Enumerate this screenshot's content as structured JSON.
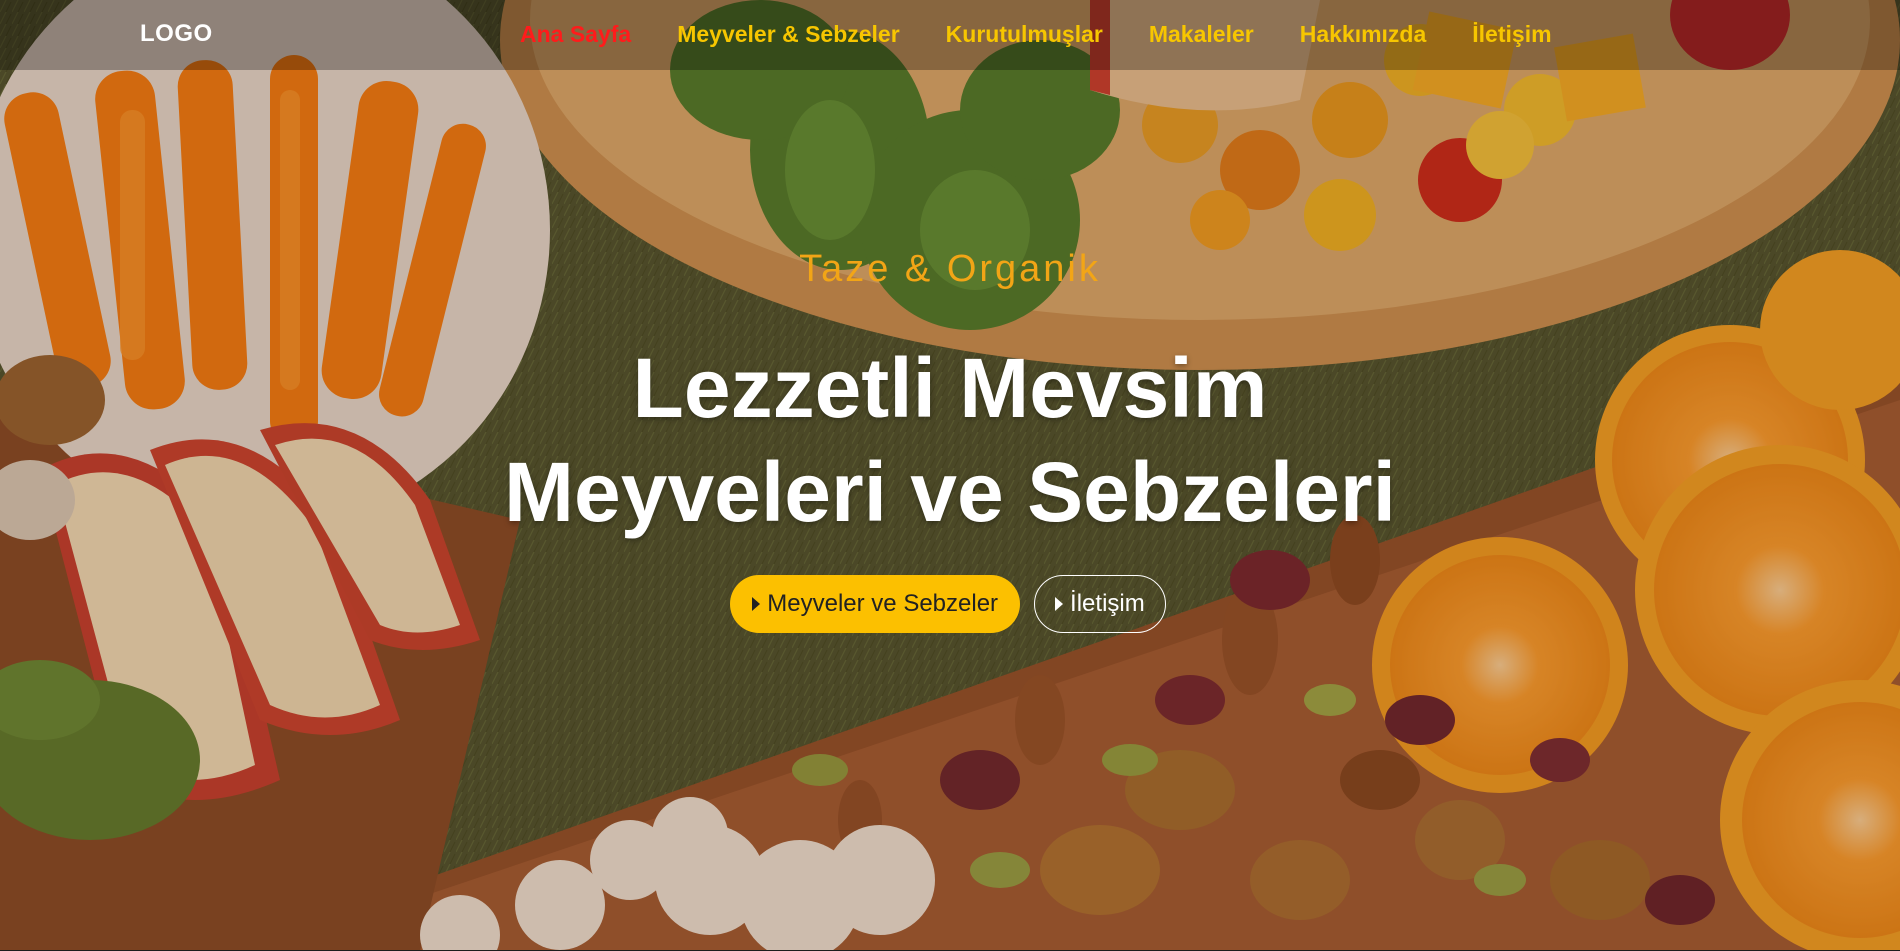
{
  "navbar": {
    "logo": "LOGO",
    "links": [
      {
        "label": "Ana Sayfa",
        "active": true
      },
      {
        "label": "Meyveler & Sebzeler",
        "active": false
      },
      {
        "label": "Kurutulmuşlar",
        "active": false
      },
      {
        "label": "Makaleler",
        "active": false
      },
      {
        "label": "Hakkımızda",
        "active": false
      },
      {
        "label": "İletişim",
        "active": false
      }
    ]
  },
  "hero": {
    "subtitle": "Taze & Organik",
    "title_line1": "Lezzetli Mevsim",
    "title_line2": "Meyveleri ve Sebzeleri",
    "buttons": {
      "primary_label": "Meyveler ve Sebzeler",
      "secondary_label": "İletişim"
    }
  },
  "colors": {
    "nav_link": "#f7c600",
    "nav_active": "#ff1b1b",
    "subtitle": "#f2a516",
    "primary_button": "#fcc000"
  },
  "icons": {
    "button_icon": "caret-right-icon",
    "background": "fruits-vegetables-nuts-photo"
  }
}
